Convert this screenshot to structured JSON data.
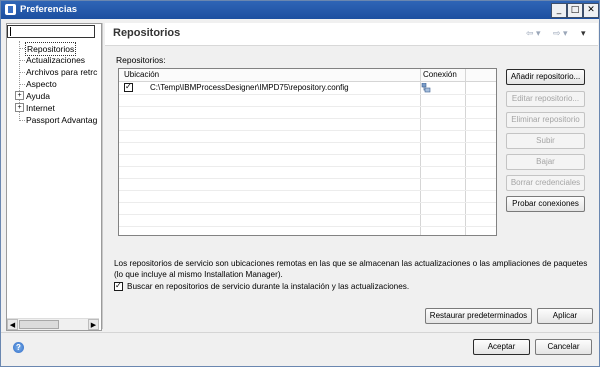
{
  "window": {
    "title": "Preferencias",
    "controls": {
      "minimize": "_",
      "maximize": "□",
      "close": "✕"
    }
  },
  "sidebar": {
    "filter_value": "",
    "items": [
      {
        "label": "Repositorios",
        "selected": true,
        "expandable": false
      },
      {
        "label": "Actualizaciones",
        "selected": false,
        "expandable": false
      },
      {
        "label": "Archivos para retrc",
        "selected": false,
        "expandable": false
      },
      {
        "label": "Aspecto",
        "selected": false,
        "expandable": false
      },
      {
        "label": "Ayuda",
        "selected": false,
        "expandable": true
      },
      {
        "label": "Internet",
        "selected": false,
        "expandable": true
      },
      {
        "label": "Passport Advantag",
        "selected": false,
        "expandable": false
      }
    ],
    "expander_symbol": "+"
  },
  "page": {
    "title": "Repositorios",
    "nav_back": "⇦ ▾",
    "nav_forward": "⇨ ▾",
    "menu": "▾"
  },
  "repositories": {
    "group_label": "Repositorios:",
    "columns": [
      "Ubicación",
      "Conexión"
    ],
    "rows": [
      {
        "checked": true,
        "location": "C:\\Temp\\IBMProcessDesigner\\IMPD75\\repository.config",
        "connection_icon": "connection-icon"
      }
    ]
  },
  "buttons": {
    "add": "Añadir repositorio...",
    "edit": "Editar repositorio...",
    "remove": "Eliminar repositorio",
    "up": "Subir",
    "down": "Bajar",
    "clear": "Borrar credenciales",
    "test": "Probar conexiones",
    "restore": "Restaurar predeterminados",
    "apply": "Aplicar",
    "ok": "Aceptar",
    "cancel": "Cancelar"
  },
  "description": "Los repositorios de servicio son ubicaciones remotas en las que se almacenan las actualizaciones o las ampliaciones de paquetes (lo que incluye al mismo Installation Manager).",
  "option": {
    "label": "Buscar en repositorios de servicio durante la instalación y las actualizaciones.",
    "checked": true
  },
  "help": "?",
  "colors": {
    "title_bar": "#1c4fa0",
    "selection_border": "#333333"
  }
}
